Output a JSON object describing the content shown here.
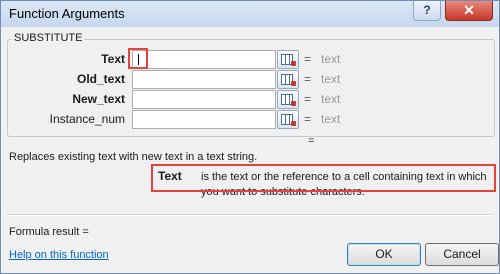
{
  "window": {
    "title": "Function Arguments",
    "help_glyph": "?",
    "close_glyph": "✕"
  },
  "function": {
    "name": "SUBSTITUTE"
  },
  "arguments": [
    {
      "label": "Text",
      "value": "",
      "result": "text"
    },
    {
      "label": "Old_text",
      "value": "",
      "result": "text"
    },
    {
      "label": "New_text",
      "value": "",
      "result": "text"
    },
    {
      "label": "Instance_num",
      "value": "",
      "result": "text"
    }
  ],
  "equals": "=",
  "result_equals": "=",
  "description": "Replaces existing text with new text in a text string.",
  "arg_help": {
    "name": "Text",
    "text": "is the text or the reference to a cell containing text in which you want to substitute characters."
  },
  "formula_result": "Formula result =",
  "help_link": "Help on this function",
  "buttons": {
    "ok": "OK",
    "cancel": "Cancel"
  },
  "highlight_color": "#e0443a"
}
